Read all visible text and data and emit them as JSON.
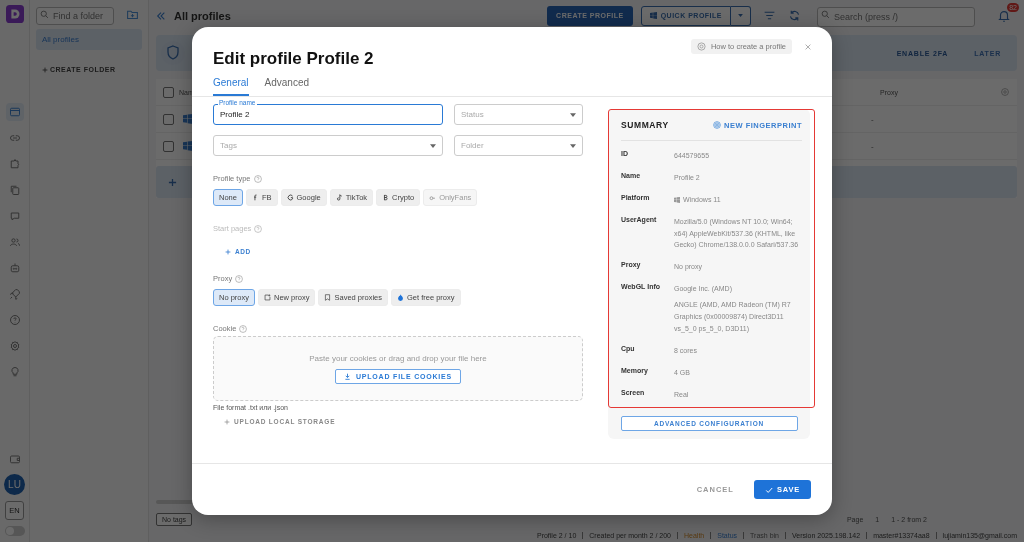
{
  "app": {
    "folder_search": {
      "placeholder": "Find a folder"
    },
    "folders": [
      {
        "label": "All profiles",
        "selected": true
      }
    ],
    "create_folder": "CREATE FOLDER",
    "page_title": "All profiles",
    "create_profile": "CREATE PROFILE",
    "quick_profile": "QUICK PROFILE",
    "search": {
      "placeholder": "Search (press /)"
    },
    "notification_count": "82",
    "banner_actions": [
      "ENABLE 2FA",
      "LATER"
    ],
    "table": {
      "all_checked": false,
      "columns": [
        "Nam",
        "Proxy"
      ],
      "rows": [
        {
          "proxy": "-",
          "checked": false
        },
        {
          "proxy": "-",
          "checked": false
        }
      ]
    },
    "dark_mode": false,
    "tags_button": "No tags",
    "page_label": "Page",
    "page_value": "1",
    "range": "1 - 2 from 2",
    "avatar": "LU",
    "language": "EN",
    "status_bar": [
      {
        "text": "Profile 2 / 10",
        "kind": "plain"
      },
      {
        "text": "Created per month 2 / 200",
        "kind": "plain"
      },
      {
        "text": "Health",
        "kind": "warn"
      },
      {
        "text": "Status",
        "kind": "link"
      },
      {
        "text": "Trash bin",
        "kind": "muted"
      },
      {
        "text": "Version 2025.198.142",
        "kind": "plain"
      },
      {
        "text": "master#13374aa8",
        "kind": "plain"
      },
      {
        "text": "lujiamin135@gmail.com",
        "kind": "plain"
      }
    ]
  },
  "dialog": {
    "title": "Edit profile Profile 2",
    "help": "How to create a profile",
    "tabs": [
      {
        "label": "General",
        "selected": true
      },
      {
        "label": "Advanced",
        "selected": false
      }
    ],
    "fields": [
      {
        "label": "Profile name",
        "value": "Profile 2",
        "focused": true,
        "dropdown": false
      },
      {
        "placeholder": "Status",
        "focused": false,
        "dropdown": true
      },
      {
        "placeholder": "Tags",
        "focused": false,
        "dropdown": true
      },
      {
        "placeholder": "Folder",
        "focused": false,
        "dropdown": true
      }
    ],
    "profile_type": {
      "label": "Profile type",
      "options": [
        {
          "label": "None",
          "selected": true,
          "disabled": false
        },
        {
          "label": "FB",
          "selected": false,
          "disabled": false
        },
        {
          "label": "Google",
          "selected": false,
          "disabled": false
        },
        {
          "label": "TikTok",
          "selected": false,
          "disabled": false
        },
        {
          "label": "Crypto",
          "selected": false,
          "disabled": false
        },
        {
          "label": "OnlyFans",
          "selected": false,
          "disabled": true
        }
      ]
    },
    "start_pages": {
      "label": "Start pages",
      "disabled": true,
      "add": "ADD"
    },
    "proxy": {
      "label": "Proxy",
      "options": [
        {
          "label": "No proxy",
          "selected": true
        },
        {
          "label": "New proxy",
          "selected": false
        },
        {
          "label": "Saved proxies",
          "selected": false
        },
        {
          "label": "Get free proxy",
          "selected": false
        }
      ]
    },
    "cookie": {
      "label": "Cookie",
      "hint": "Paste your cookies or drag and drop your file here",
      "upload": "UPLOAD FILE COOKIES",
      "format": "File format .txt или .json",
      "local_storage": "UPLOAD LOCAL STORAGE"
    },
    "summary": {
      "title": "SUMMARY",
      "new_fingerprint": "NEW FINGERPRINT",
      "rows": [
        {
          "label": "ID",
          "values": [
            "644579655"
          ],
          "kind": "text"
        },
        {
          "label": "Name",
          "values": [
            "Profile 2"
          ],
          "kind": "text"
        },
        {
          "label": "Platform",
          "values": [
            "Windows 11"
          ],
          "kind": "os"
        },
        {
          "label": "UserAgent",
          "values": [
            "Mozilla/5.0 (Windows NT 10.0; Win64; x64) AppleWebKit/537.36 (KHTML, like Gecko) Chrome/138.0.0.0 Safari/537.36"
          ],
          "kind": "text"
        },
        {
          "label": "Proxy",
          "values": [
            "No proxy"
          ],
          "kind": "text"
        },
        {
          "label": "WebGL Info",
          "values": [
            "Google Inc. (AMD)",
            "ANGLE (AMD, AMD Radeon (TM) R7 Graphics (0x00009874) Direct3D11 vs_5_0 ps_5_0, D3D11)"
          ],
          "kind": "text"
        },
        {
          "label": "Cpu",
          "values": [
            "8 cores"
          ],
          "kind": "text"
        },
        {
          "label": "Memory",
          "values": [
            "4 GB"
          ],
          "kind": "text"
        },
        {
          "label": "Screen",
          "values": [
            "Real"
          ],
          "kind": "text"
        }
      ],
      "advanced": "ADVANCED CONFIGURATION"
    },
    "cancel": "CANCEL",
    "save": "SAVE"
  }
}
